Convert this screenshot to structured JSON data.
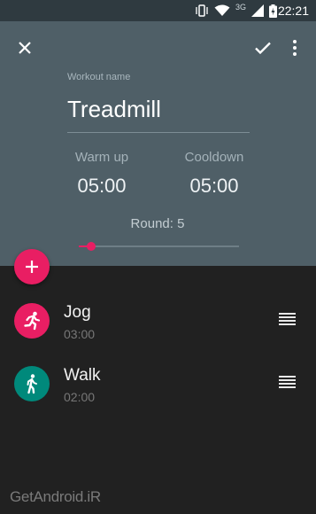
{
  "status_bar": {
    "time": "22:21",
    "network": "3G",
    "icons": [
      "vibrate-icon",
      "wifi-icon",
      "signal-icon",
      "battery-charging-icon"
    ]
  },
  "toolbar": {
    "close_icon": "close-icon",
    "save_icon": "check-icon",
    "more_icon": "more-vert-icon"
  },
  "form": {
    "name_label": "Workout name",
    "name_value": "Treadmill",
    "warmup_label": "Warm up",
    "warmup_value": "05:00",
    "cooldown_label": "Cooldown",
    "cooldown_value": "05:00",
    "round_label": "Round: 5",
    "rounds_slider_fraction": 0.08
  },
  "fab": {
    "icon": "plus-icon"
  },
  "exercises": [
    {
      "title": "Jog",
      "duration": "03:00",
      "icon": "running-icon",
      "color": "#e91e63"
    },
    {
      "title": "Walk",
      "duration": "02:00",
      "icon": "walking-icon",
      "color": "#00897b"
    }
  ],
  "watermark": "GetAndroid.iR",
  "colors": {
    "accent": "#e91e63",
    "header": "#4f5f67",
    "status_bar": "#2f3a40",
    "background": "#212121",
    "walk": "#00897b"
  }
}
